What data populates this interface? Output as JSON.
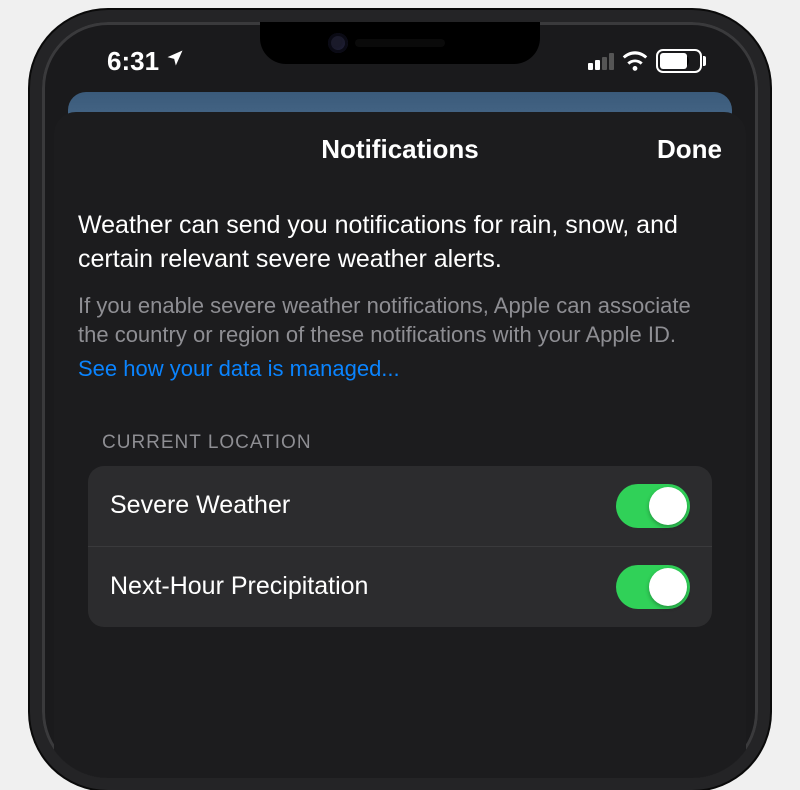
{
  "status_bar": {
    "time": "6:31",
    "battery_level": "70"
  },
  "modal": {
    "title": "Notifications",
    "done_label": "Done",
    "primary_text": "Weather can send you notifications for rain, snow, and certain relevant severe weather alerts.",
    "secondary_text": "If you enable severe weather notifications, Apple can associate the country or region of these notifications with your Apple ID.",
    "link_text": "See how your data is managed...",
    "section_header": "CURRENT LOCATION",
    "toggles": [
      {
        "label": "Severe Weather",
        "enabled": true
      },
      {
        "label": "Next-Hour Precipitation",
        "enabled": true
      }
    ]
  },
  "colors": {
    "accent_green": "#30d158",
    "link_blue": "#0a84ff",
    "modal_bg": "#1c1c1e",
    "cell_bg": "#2c2c2e"
  }
}
